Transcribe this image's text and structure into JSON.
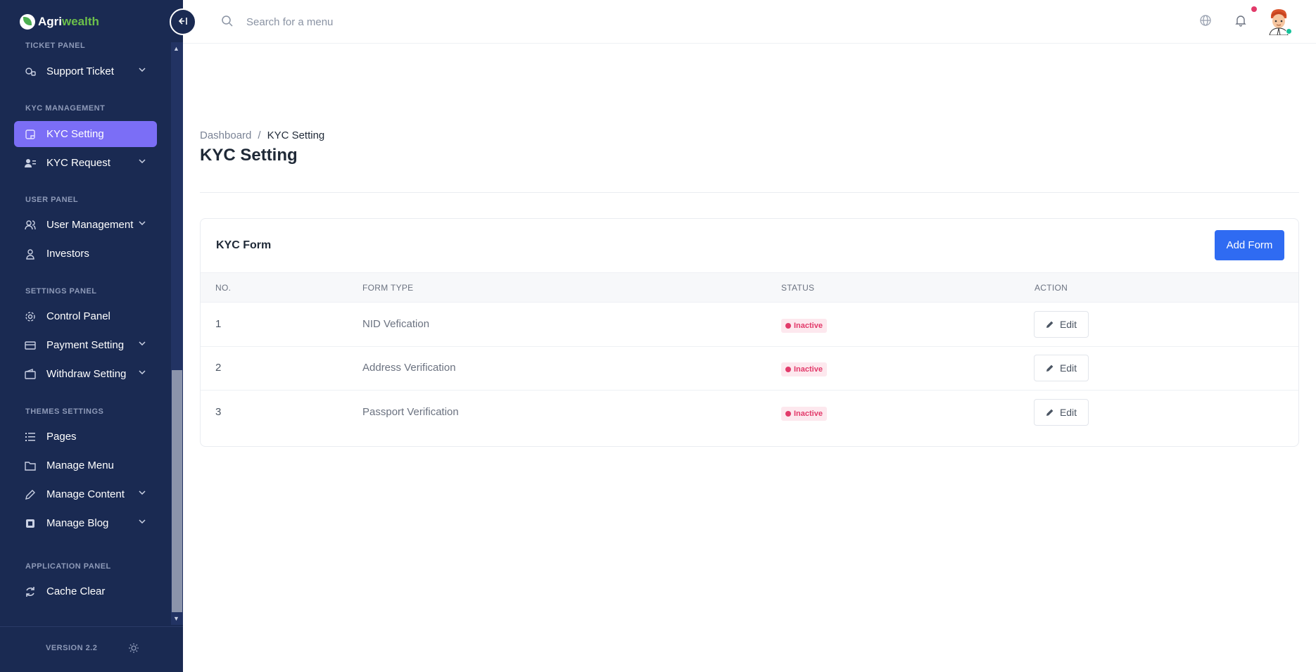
{
  "brand": {
    "part1": "Agri",
    "part2": "wealth"
  },
  "sidebar": {
    "sections": [
      {
        "title": "TICKET PANEL",
        "items": [
          {
            "label": "Support Ticket",
            "icon": "headset-icon",
            "has_children": true
          }
        ]
      },
      {
        "title": "KYC MANAGEMENT",
        "items": [
          {
            "label": "KYC Setting",
            "icon": "note-icon",
            "active": true
          },
          {
            "label": "KYC Request",
            "icon": "users-list-icon",
            "has_children": true
          }
        ]
      },
      {
        "title": "USER PANEL",
        "items": [
          {
            "label": "User Management",
            "icon": "users-icon",
            "has_children": true
          },
          {
            "label": "Investors",
            "icon": "investor-icon"
          }
        ]
      },
      {
        "title": "SETTINGS PANEL",
        "items": [
          {
            "label": "Control Panel",
            "icon": "gear-icon"
          },
          {
            "label": "Payment Setting",
            "icon": "card-icon",
            "has_children": true
          },
          {
            "label": "Withdraw Setting",
            "icon": "wallet-icon",
            "has_children": true
          }
        ]
      },
      {
        "title": "THEMES SETTINGS",
        "items": [
          {
            "label": "Pages",
            "icon": "list-icon"
          },
          {
            "label": "Manage Menu",
            "icon": "folder-icon"
          },
          {
            "label": "Manage Content",
            "icon": "pencil-icon",
            "has_children": true
          },
          {
            "label": "Manage Blog",
            "icon": "blog-icon",
            "has_children": true
          }
        ]
      },
      {
        "title": "APPLICATION PANEL",
        "items": [
          {
            "label": "Cache Clear",
            "icon": "refresh-icon"
          }
        ]
      }
    ],
    "version": "VERSION 2.2"
  },
  "header": {
    "search_placeholder": "Search for a menu"
  },
  "breadcrumb": {
    "home": "Dashboard",
    "separator": "/",
    "current": "KYC Setting"
  },
  "page_title": "KYC Setting",
  "card": {
    "title": "KYC Form",
    "add_button": "Add Form",
    "columns": [
      "NO.",
      "FORM TYPE",
      "STATUS",
      "ACTION"
    ],
    "rows": [
      {
        "no": "1",
        "form_type": "NID Vefication",
        "status": "Inactive",
        "action": "Edit"
      },
      {
        "no": "2",
        "form_type": "Address Verification",
        "status": "Inactive",
        "action": "Edit"
      },
      {
        "no": "3",
        "form_type": "Passport Verification",
        "status": "Inactive",
        "action": "Edit"
      }
    ]
  },
  "colors": {
    "sidebar_bg": "#1a2a52",
    "active_item": "#7b6ef6",
    "primary_button": "#2f6bf2",
    "inactive_badge": "#e23a6a"
  }
}
